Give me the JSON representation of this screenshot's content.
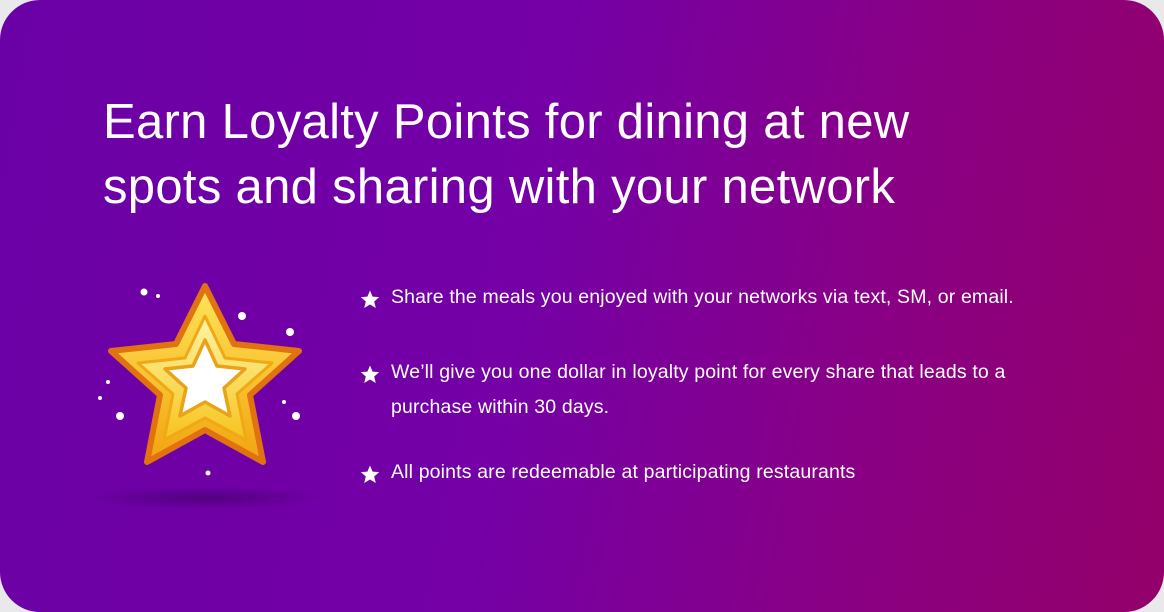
{
  "card": {
    "headline": "Earn Loyalty Points for dining at new spots and sharing with your network",
    "illustration_icon": "star-icon",
    "bullet_icon": "star-icon",
    "bullets": [
      {
        "text": "Share the meals you enjoyed with your networks via text, SM, or email."
      },
      {
        "text": "We’ll give you one dollar in loyalty point for every share that leads to a purchase within 30 days."
      },
      {
        "text": "All points are redeemable at participating restaurants"
      }
    ]
  },
  "colors": {
    "gradient_start": "#6a01a6",
    "gradient_end": "#94006a",
    "text": "#ffffff",
    "star_gold": "#f7c51e",
    "star_outline": "#e0720f"
  }
}
